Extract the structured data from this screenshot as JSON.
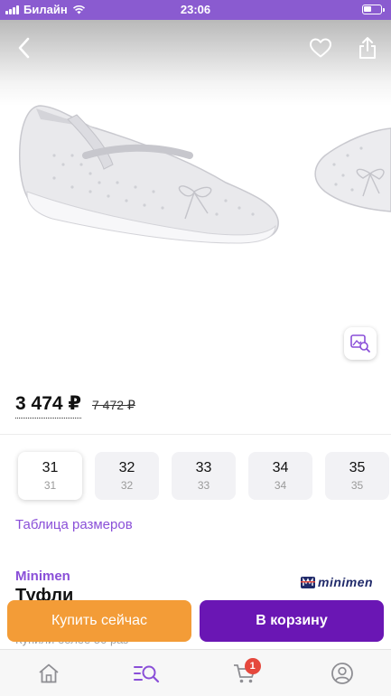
{
  "status_bar": {
    "carrier": "Билайн",
    "time": "23:06"
  },
  "header": {
    "back_icon": "chevron-left-icon",
    "favorite_icon": "heart-icon",
    "share_icon": "share-icon"
  },
  "gallery": {
    "image_search_icon": "image-search-icon"
  },
  "price": {
    "current": "3 474 ₽",
    "old": "7 472 ₽"
  },
  "sizes": [
    {
      "size": "31",
      "sub": "31",
      "selected": true
    },
    {
      "size": "32",
      "sub": "32",
      "selected": false
    },
    {
      "size": "33",
      "sub": "33",
      "selected": false
    },
    {
      "size": "34",
      "sub": "34",
      "selected": false
    },
    {
      "size": "35",
      "sub": "35",
      "selected": false
    }
  ],
  "size_table_link": "Таблица размеров",
  "brand": {
    "name": "Minimen",
    "logo_text": "minimen"
  },
  "product_title": "Туфли",
  "bought_text": "Купили более 50 раз",
  "actions": {
    "buy_now": "Купить сейчас",
    "add_to_cart": "В корзину"
  },
  "bottom_nav": {
    "items": [
      {
        "icon": "home-icon"
      },
      {
        "icon": "catalog-search-icon",
        "active": true
      },
      {
        "icon": "cart-icon",
        "badge": "1"
      },
      {
        "icon": "profile-icon"
      }
    ]
  },
  "colors": {
    "accent": "#8a4fd8",
    "buy_button": "#f39c37",
    "cart_button": "#6a16b4",
    "badge": "#e5483d"
  }
}
